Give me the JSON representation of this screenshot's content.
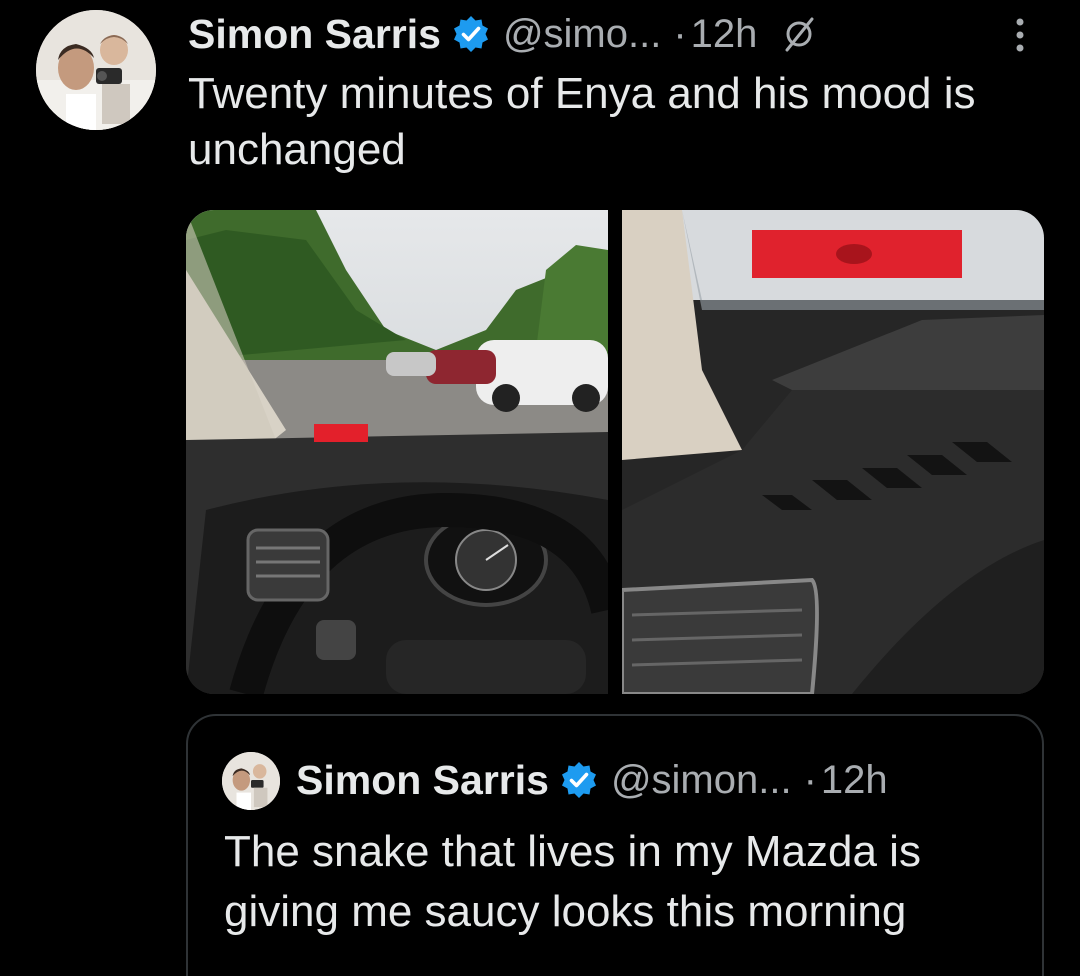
{
  "tweet": {
    "author_name": "Simon Sarris",
    "handle": "@simo...",
    "separator": "·",
    "time": "12h",
    "text": "Twenty minutes of Enya and his mood is unchanged",
    "verified_icon": "verified-badge-icon",
    "edit_icon": "no-edit-icon",
    "menu_icon": "more-vertical-icon",
    "media": [
      {
        "alt": "car-windshield-parking-lot-photo"
      },
      {
        "alt": "car-dashboard-vent-photo"
      }
    ]
  },
  "quote": {
    "author_name": "Simon Sarris",
    "handle": "@simon...",
    "separator": "·",
    "time": "12h",
    "text": "The snake that lives in my Mazda is giving me saucy looks this morning"
  },
  "colors": {
    "background": "#000000",
    "text_primary": "#e7e9ea",
    "text_secondary": "#a9adb1",
    "verified_blue": "#1d9bf0",
    "border": "#2f3336"
  }
}
